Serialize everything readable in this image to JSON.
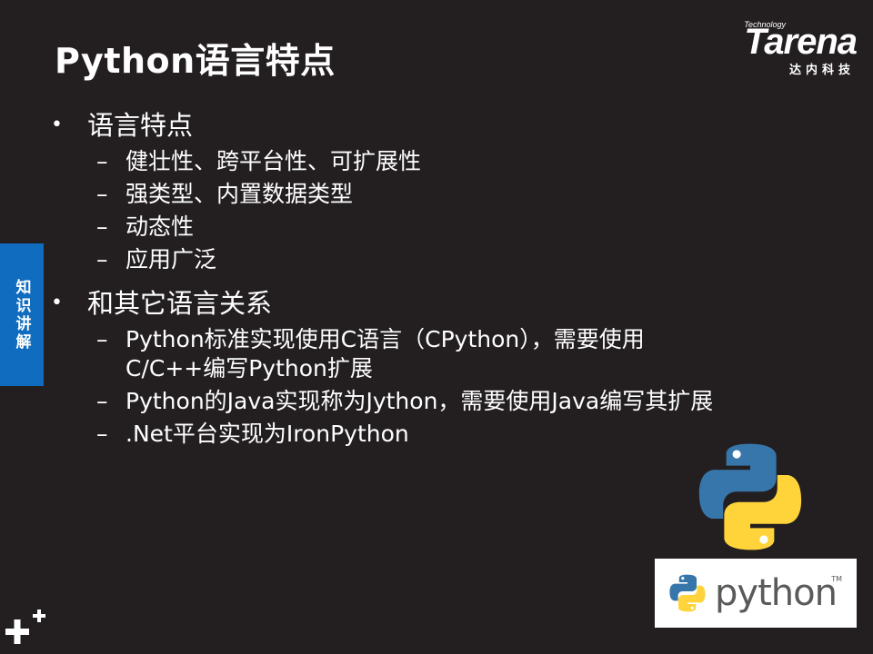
{
  "slide": {
    "title": "Python语言特点",
    "side_tab": "知识讲解",
    "logo": {
      "technology": "Technology",
      "brand": "Tarena",
      "cn": "达内科技"
    },
    "sections": [
      {
        "heading": "语言特点",
        "items": [
          "健壮性、跨平台性、可扩展性",
          "强类型、内置数据类型",
          "动态性",
          "应用广泛"
        ]
      },
      {
        "heading": "和其它语言关系",
        "items": [
          [
            "Python标准实现使用C语言（CPython），需要使用",
            "C/C++编写Python扩展"
          ],
          "Python的Java实现称为Jython，需要使用Java编写其扩展",
          ".Net平台实现为IronPython"
        ]
      }
    ],
    "python_badge": {
      "word": "python",
      "tm": "TM"
    },
    "bullet_glyph": "•",
    "dash_glyph": "–",
    "colors": {
      "background": "#231f20",
      "side_tab": "#0f6cbf",
      "text": "#ffffff",
      "python_blue": "#3776ab",
      "python_yellow": "#ffd43b"
    }
  }
}
